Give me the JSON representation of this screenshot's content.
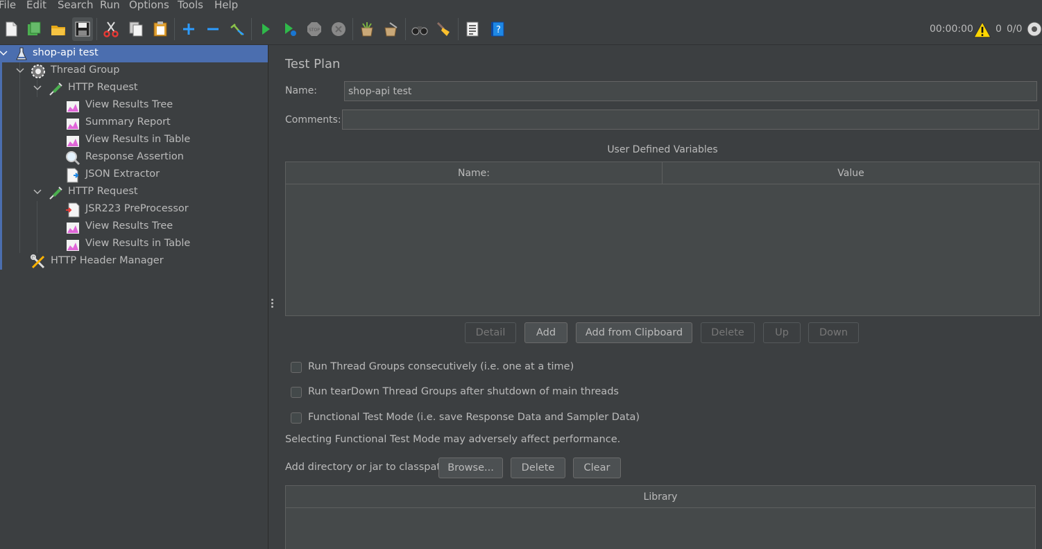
{
  "menu": [
    "File",
    "Edit",
    "Search",
    "Run",
    "Options",
    "Tools",
    "Help"
  ],
  "toolbar": {
    "buttons": [
      "new-icon",
      "templates-icon",
      "open-icon",
      "save-icon",
      "cut-icon",
      "copy-icon",
      "paste-icon",
      "expand-icon",
      "collapse-icon",
      "toggle-icon",
      "start-icon",
      "start-no-pauses-icon",
      "stop-icon",
      "shutdown-icon",
      "clear-icon",
      "clear-all-icon",
      "search-icon",
      "reset-search-icon",
      "function-helper-icon",
      "help-icon"
    ],
    "timer": "00:00:00",
    "warning_count": "0",
    "threads": "0/0"
  },
  "tree": [
    {
      "label": "shop-api test",
      "icon": "test-plan-icon",
      "selected": true
    },
    {
      "label": "Thread Group",
      "icon": "thread-group-icon"
    },
    {
      "label": "HTTP Request",
      "icon": "sampler-icon"
    },
    {
      "label": "View Results Tree",
      "icon": "listener-icon"
    },
    {
      "label": "Summary Report",
      "icon": "listener-icon"
    },
    {
      "label": "View Results in Table",
      "icon": "listener-icon"
    },
    {
      "label": "Response Assertion",
      "icon": "assertion-icon"
    },
    {
      "label": "JSON Extractor",
      "icon": "extractor-icon"
    },
    {
      "label": "HTTP Request",
      "icon": "sampler-icon"
    },
    {
      "label": "JSR223 PreProcessor",
      "icon": "preprocessor-icon"
    },
    {
      "label": "View Results Tree",
      "icon": "listener-icon"
    },
    {
      "label": "View Results in Table",
      "icon": "listener-icon"
    },
    {
      "label": "HTTP Header Manager",
      "icon": "config-icon"
    }
  ],
  "panel": {
    "title": "Test Plan",
    "name_label": "Name:",
    "name_value": "shop-api test",
    "comments_label": "Comments:",
    "comments_value": "",
    "udv_title": "User Defined Variables",
    "udv_headers": [
      "Name:",
      "Value"
    ],
    "buttons": {
      "detail": "Detail",
      "add": "Add",
      "add_clipboard": "Add from Clipboard",
      "delete": "Delete",
      "up": "Up",
      "down": "Down"
    },
    "checkboxes": [
      {
        "label": "Run Thread Groups consecutively (i.e. one at a time)",
        "checked": false
      },
      {
        "label": "Run tearDown Thread Groups after shutdown of main threads",
        "checked": false
      },
      {
        "label": "Functional Test Mode (i.e. save Response Data and Sampler Data)",
        "checked": false
      }
    ],
    "functional_note": "Selecting Functional Test Mode may adversely affect performance.",
    "classpath_label": "Add directory or jar to classpath",
    "classpath_buttons": {
      "browse": "Browse...",
      "delete": "Delete",
      "clear": "Clear"
    },
    "library_header": "Library"
  },
  "colors": {
    "background": "#3c3f41",
    "selection": "#4b6eaf",
    "text": "#bbbbbb"
  }
}
